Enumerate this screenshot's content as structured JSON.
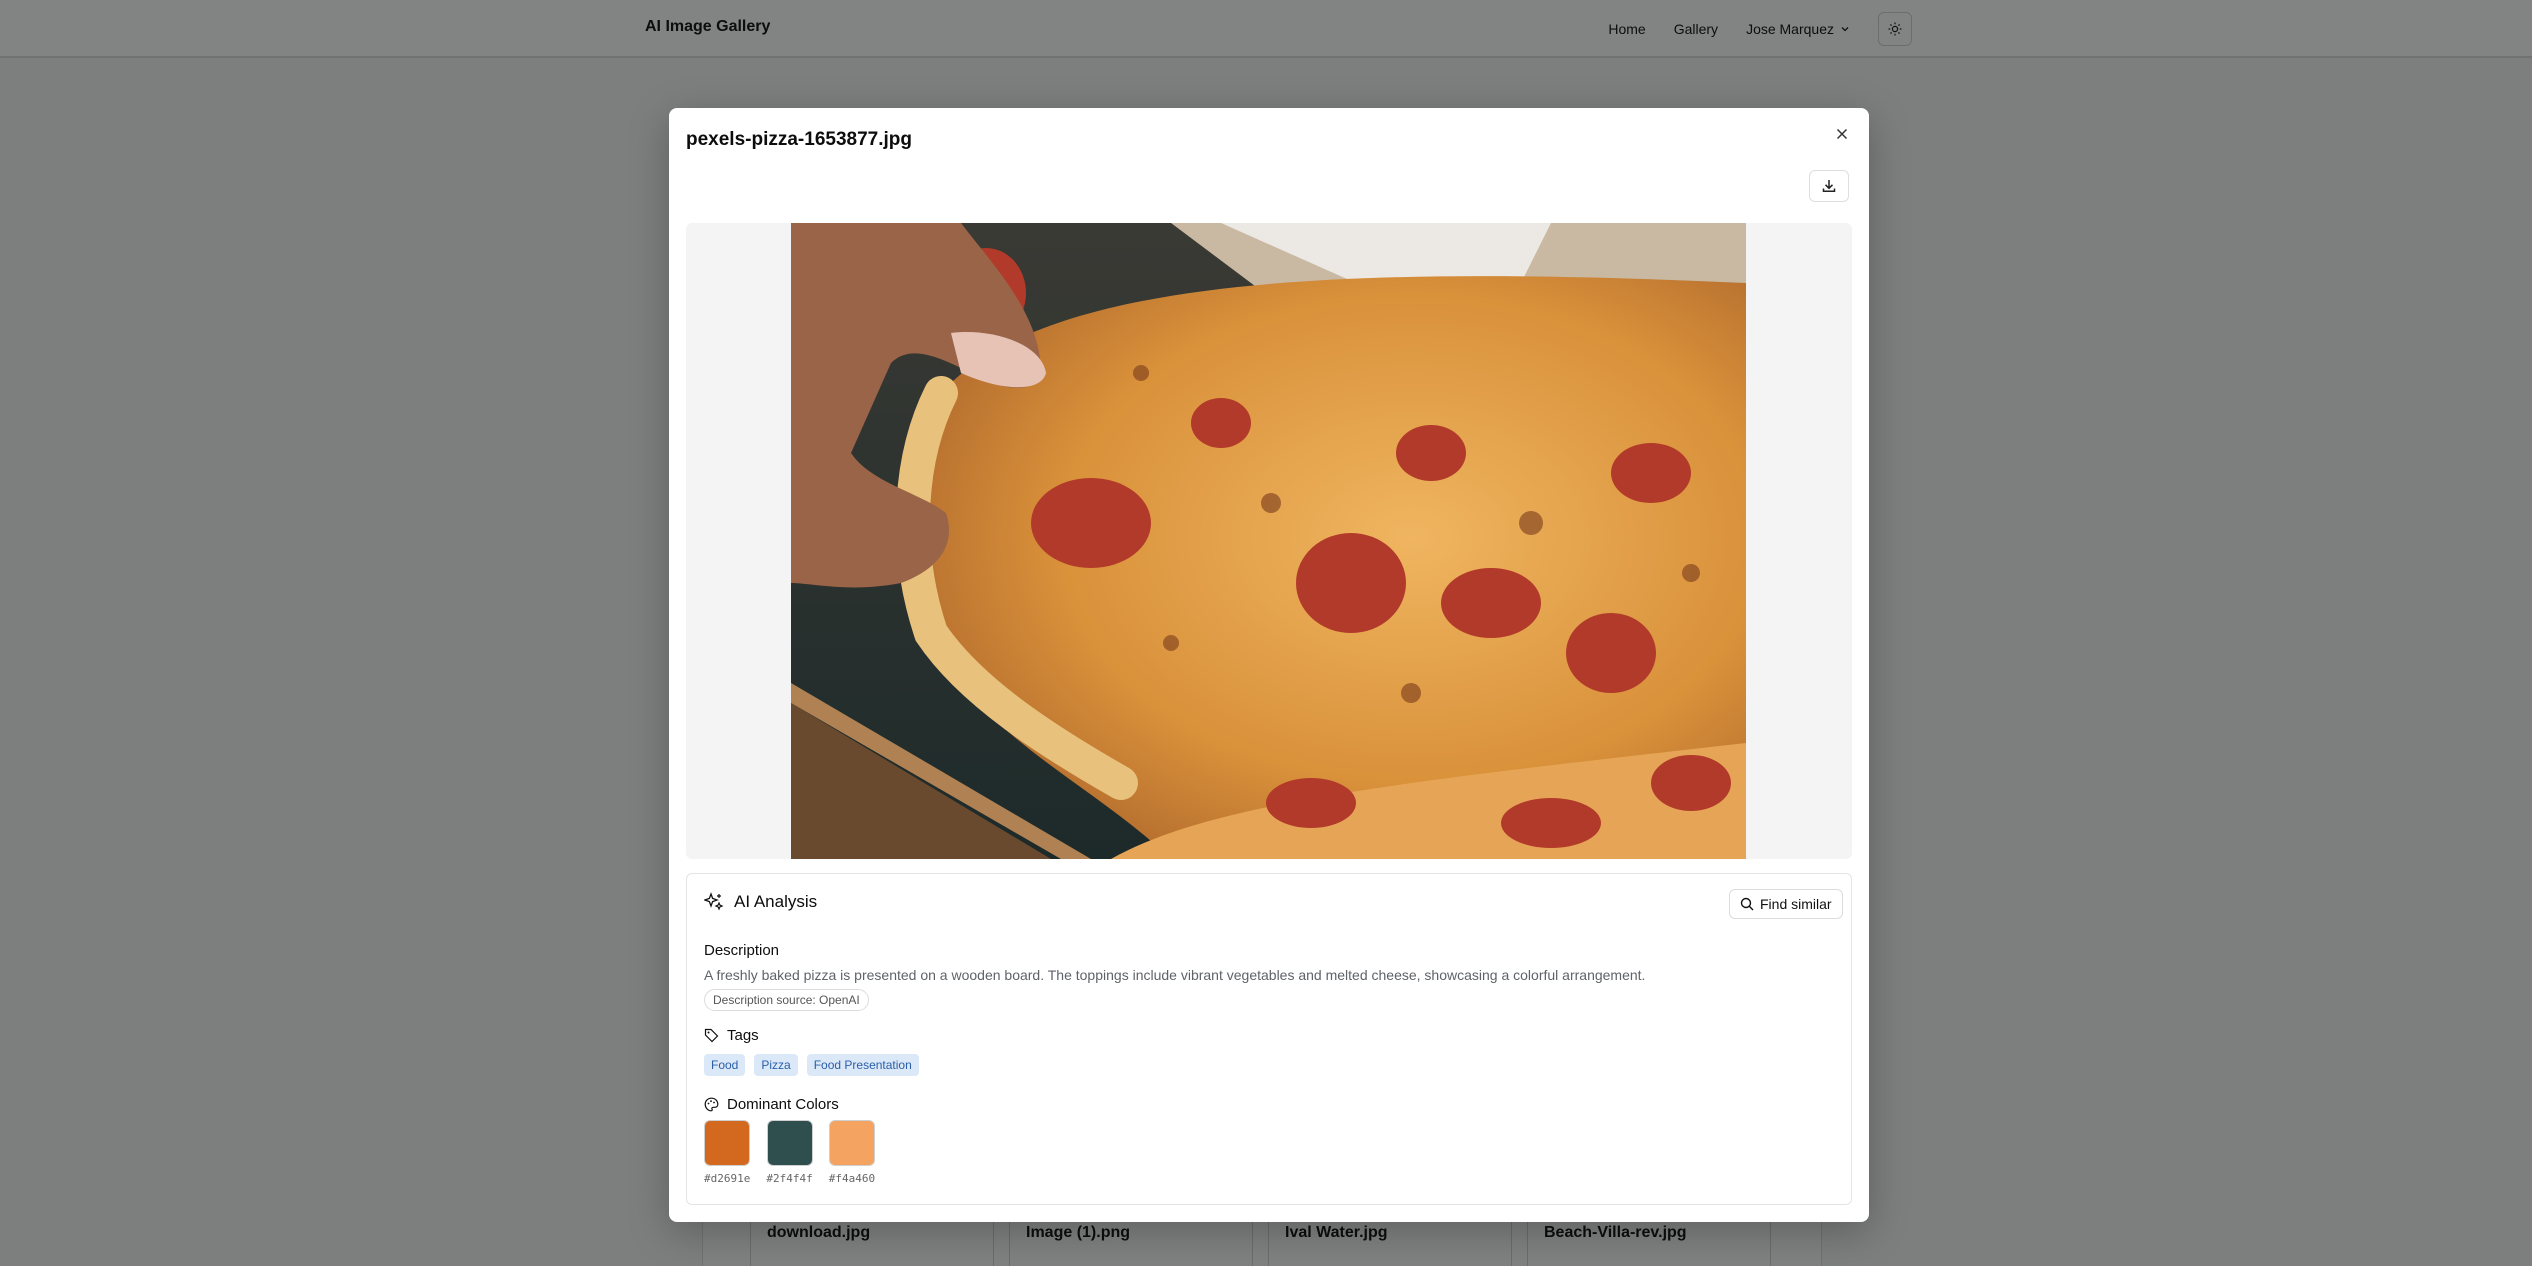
{
  "app": {
    "brand": "AI Image Gallery",
    "nav": {
      "home": "Home",
      "gallery": "Gallery",
      "user": "Jose Marquez"
    },
    "theme_icon": "sun-icon"
  },
  "background_cards": [
    {
      "title": "download.jpg"
    },
    {
      "title": "Image (1).png"
    },
    {
      "title": "Ival Water.jpg"
    },
    {
      "title": "Beach-Villa-rev.jpg"
    }
  ],
  "modal": {
    "title": "pexels-pizza-1653877.jpg",
    "close_icon": "close-icon",
    "download_icon": "download-icon",
    "analysis": {
      "heading": "AI Analysis",
      "find_similar": "Find similar",
      "description_label": "Description",
      "description": "A freshly baked pizza is presented on a wooden board. The toppings include vibrant vegetables and melted cheese, showcasing a colorful arrangement.",
      "source": "Description source: OpenAI",
      "tags_label": "Tags",
      "tags": [
        "Food",
        "Pizza",
        "Food Presentation"
      ],
      "colors_label": "Dominant Colors",
      "colors": [
        {
          "hex": "#d2691e"
        },
        {
          "hex": "#2f4f4f"
        },
        {
          "hex": "#f4a460"
        }
      ]
    }
  }
}
